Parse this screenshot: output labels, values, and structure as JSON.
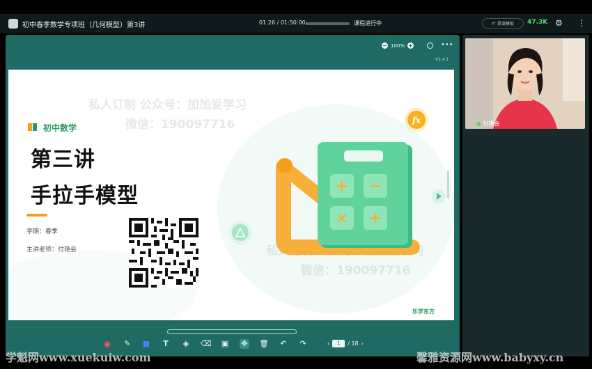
{
  "header": {
    "title": "初中春季数学专项班（几何模型）第3讲",
    "time": "01:26  /  01:50:00",
    "progress_fraction": 0.013,
    "status": "课程进行中",
    "pill_label": "提课模板",
    "viewer_count": "47.3K"
  },
  "stage": {
    "zoom": "100%",
    "version": "V2.4.1"
  },
  "slide": {
    "subject": "初中数学",
    "lesson": "第三讲",
    "topic": "手拉手模型",
    "term": "学期：春季",
    "teacher": "主讲老师：付艳会",
    "brand": "乐学东方",
    "watermark_1a": "私人订制 公众号：加加爱学习",
    "watermark_1b": "微信：190097716",
    "watermark_2a": "私人订制 公众号：加加爱学习",
    "watermark_2b": "微信：190097716"
  },
  "pagination": {
    "current": "1",
    "total": "/ 18"
  },
  "video": {
    "teacher_name": "付艳会"
  },
  "overlay": {
    "left_watermark": "学魁网www.xuekuiw.com",
    "right_watermark": "馨雅资源网www.babyxy.cn"
  },
  "colors": {
    "stage_bg": "#1f6b64",
    "accent_green": "#2a9a62",
    "orange": "#f6a01a",
    "viewer_green": "#5fd36a"
  },
  "icons": [
    "app-icon",
    "gear-icon",
    "more-icon",
    "zoom-out-icon",
    "zoom-in-icon",
    "fullscreen-icon",
    "record-icon",
    "pen-icon",
    "shape-icon",
    "text-icon",
    "fill-icon",
    "eraser-icon",
    "image-icon",
    "move-icon",
    "trash-icon",
    "undo-icon",
    "redo-icon"
  ]
}
